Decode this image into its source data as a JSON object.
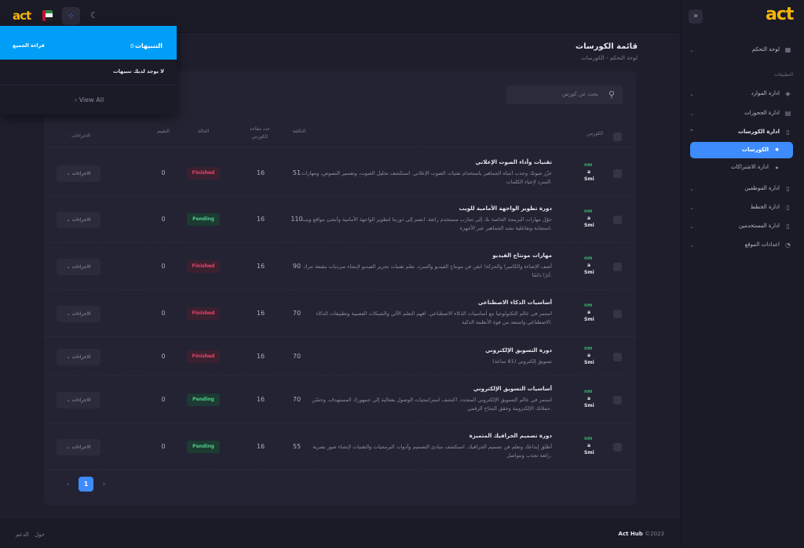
{
  "brand": {
    "logo_text": "act",
    "accent": "#3d8bfd",
    "logo_color": "#f5b40c"
  },
  "sidebar": {
    "section_label": "التطبيقات",
    "items": [
      {
        "label": "لوحة التحكم",
        "icon": "dashboard-icon"
      },
      {
        "label": "ادارة الموارد",
        "icon": "layers-icon"
      },
      {
        "label": "ادارة الحجوزات",
        "icon": "calendar-icon"
      },
      {
        "label": "ادارة الكورسات",
        "icon": "file-icon"
      },
      {
        "label": "الكورسات",
        "icon": "bullet-icon"
      },
      {
        "label": "ادارة الاشتراكات",
        "icon": "bullet-icon"
      },
      {
        "label": "ادارة الموظفين",
        "icon": "file-icon"
      },
      {
        "label": "ادارة الخطط",
        "icon": "file-icon"
      },
      {
        "label": "ادارة المستخدمين",
        "icon": "file-icon"
      },
      {
        "label": "اعدادات الموقع",
        "icon": "spinner-icon"
      }
    ]
  },
  "header": {
    "page_title": "قائمة الكورسات",
    "breadcrumb_home": "لوحة التحكم",
    "breadcrumb_sep": "-",
    "breadcrumb_current": "الكورسات"
  },
  "search": {
    "placeholder": "بحث عن كورس"
  },
  "table": {
    "columns": {
      "course": "الكورس",
      "cost": "التكلفة",
      "seats_line1": "عدد مقاعد",
      "seats_line2": "الكورس",
      "status": "الحالة",
      "rating": "التقييم",
      "actions": "الاجراءات"
    },
    "thumb_text": {
      "l1": "nm",
      "l2": "a",
      "l3": "Smi"
    },
    "action_label": "الاجراءات",
    "rows": [
      {
        "title": "تقنيات وأداء الصوت الإعلاني",
        "desc": "عزّز صوتك وجذب انتباه الجماهير باستخدام تقنيات الصوت الإعلاني. استكشف تحليل الصوت، وتفسير النصوص، ومهارات السرد لإحياء الكلمات.",
        "cost": "51",
        "seats": "16",
        "status": "Finished",
        "rating": "0"
      },
      {
        "title": "دورة تطوير الواجهة الأمامية للويب",
        "desc": "حوّل مهارات البرمجة الخاصة بك إلى تجارب مستخدم رائعة. انضم إلى دورتنا لتطوير الواجهة الأمامية وأنشئ مواقع ويب استجابة وتفاعلية تشد الجماهير عبر الأجهزة.",
        "cost": "110",
        "seats": "16",
        "status": "Pending",
        "rating": "0"
      },
      {
        "title": "مهارات مونتاج الفيديو",
        "desc": "أضف الإضاءة والكاميرا والحركة! انقن فن مونتاج الفيديو والسرد. تعلم تقنيات تحرير الفيديو لإنشاء سرديات مقنعة تترك أثرًا دائمًا.",
        "cost": "90",
        "seats": "16",
        "status": "Finished",
        "rating": "0"
      },
      {
        "title": "أساسيات الذكاء الاصطناعي",
        "desc": "استمر في عالم التكنولوجيا مع أساسيات الذكاء الاصطناعي. افهم التعلم الآلي والشبكات العصبية وتطبيقات الذكاء الاصطناعي واستعد من قوة الأنظمة الذكية.",
        "cost": "70",
        "seats": "16",
        "status": "Finished",
        "rating": "0"
      },
      {
        "title": "دورة التسويق الإلكتروني",
        "desc": "تسويق إلكتروني (81 ساعة)",
        "cost": "70",
        "seats": "16",
        "status": "Finished",
        "rating": "0"
      },
      {
        "title": "أساسيات التسويق الإلكتروني",
        "desc": "استمر في عالم التسويق الإلكتروني المتجدد. اكتشف استراتيجيات الوصول بفعالية إلى جمهورك المستهدف، وحسّن حملاتك الإلكترونية وحقق النجاح الرقمي.",
        "cost": "70",
        "seats": "16",
        "status": "Pending",
        "rating": "0"
      },
      {
        "title": "دورة تصميم الجرافيك المتميزة",
        "desc": "أطلق إبداعك وتعلم فن تصميم الجرافيك. استكشف مبادئ التصميم وأدوات البرمجيات والتقنيات لإنشاء صور بصرية رائعة تجذب وتتواصل.",
        "cost": "55",
        "seats": "16",
        "status": "Pending",
        "rating": "0"
      }
    ]
  },
  "pagination": {
    "prev": "‹",
    "current": "1",
    "next": "›"
  },
  "notifications": {
    "title": "التنبيهات",
    "count": "0",
    "read_all": "قراءة الجميع",
    "empty": "لا يوجد لديك تنبيهات",
    "view_all": "View All",
    "view_all_arrow": "›"
  },
  "footer": {
    "brand": "Act Hub",
    "year": "©2023",
    "about": "حول",
    "support": "الدعم"
  }
}
